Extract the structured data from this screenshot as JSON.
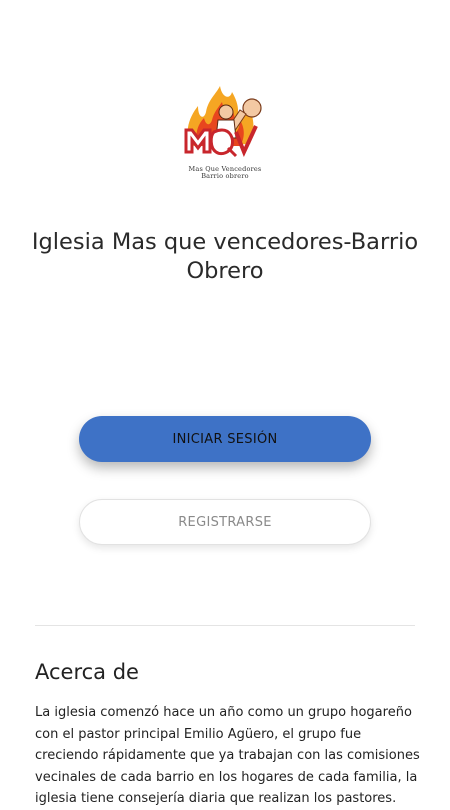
{
  "logo": {
    "icon": "church-flame-fist-logo",
    "caption_line1": "Mas Que Vencedores",
    "caption_line2": "Barrio obrero",
    "colors": {
      "flame": "#f5a623",
      "flame_inner": "#e8461e",
      "letters": "#c8262c"
    }
  },
  "title": "Iglesia Mas que vencedores-Barrio Obrero",
  "buttons": {
    "login_label": "INICIAR SESIÓN",
    "register_label": "REGISTRARSE"
  },
  "about": {
    "heading": "Acerca de",
    "text": "La iglesia comenzó hace un año como un grupo hogareño con el pastor principal Emilio Agüero, el grupo fue creciendo rápidamente que ya trabajan con las comisiones vecinales de cada barrio en los hogares de cada familia, la iglesia tiene consejería diaria que realizan los pastores."
  },
  "colors": {
    "accent": "#3e72c6",
    "background": "#ffffff"
  }
}
